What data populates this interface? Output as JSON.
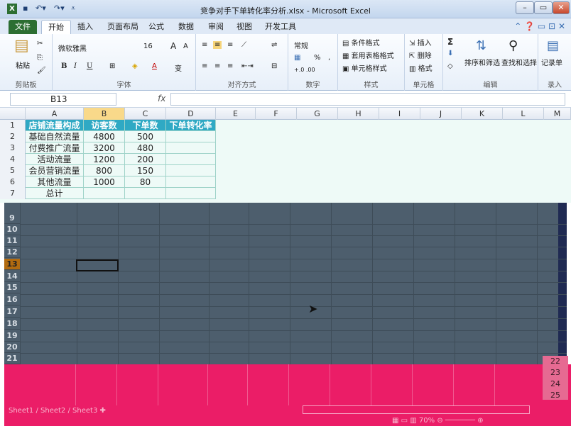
{
  "window": {
    "title": "竞争对手下单转化率分析.xlsx - Microsoft Excel",
    "min": "–",
    "max": "▭",
    "close": "✕"
  },
  "tabs": [
    "文件",
    "开始",
    "插入",
    "页面布局",
    "公式",
    "数据",
    "审阅",
    "视图",
    "开发工具"
  ],
  "ribbon": {
    "clipboard": {
      "paste": "粘贴",
      "label": "剪贴板"
    },
    "font": {
      "name": "微软雅黑",
      "size": "16",
      "grow": "A",
      "shrink": "A",
      "bold": "B",
      "italic": "I",
      "underline": "U",
      "wen": "变",
      "label": "字体"
    },
    "align": {
      "label": "对齐方式"
    },
    "number": {
      "format": "常规",
      "percent": "%",
      "comma": ",",
      "label": "数字"
    },
    "styles": {
      "cond": "条件格式",
      "table": "套用表格格式",
      "cell": "单元格样式",
      "label": "样式"
    },
    "cells": {
      "insert": "插入",
      "delete": "删除",
      "format": "格式",
      "label": "单元格"
    },
    "editing": {
      "sigma": "Σ",
      "sort": "排序和筛选",
      "find": "查找和选择",
      "label": "编辑"
    },
    "record": {
      "btn": "记录单",
      "label": "录入"
    }
  },
  "formula": {
    "namebox": "B13",
    "fx": "fx"
  },
  "columns": [
    "A",
    "B",
    "C",
    "D",
    "E",
    "F",
    "G",
    "H",
    "I",
    "J",
    "K",
    "L",
    "M"
  ],
  "table": {
    "headers": [
      "店铺流量构成",
      "访客数",
      "下单数",
      "下单转化率"
    ],
    "rows": [
      [
        "基础自然流量",
        "4800",
        "500",
        ""
      ],
      [
        "付费推广流量",
        "3200",
        "480",
        ""
      ],
      [
        "活动流量",
        "1200",
        "200",
        ""
      ],
      [
        "会员营销流量",
        "800",
        "150",
        ""
      ],
      [
        "其他流量",
        "1000",
        "80",
        ""
      ],
      [
        "总计",
        "",
        "",
        ""
      ]
    ]
  },
  "row_numbers": [
    "1",
    "2",
    "3",
    "4",
    "5",
    "6",
    "7"
  ],
  "dark_rows": [
    "9",
    "10",
    "11",
    "12",
    "13",
    "14",
    "15",
    "16",
    "17",
    "18",
    "19",
    "20",
    "21"
  ],
  "right_rows": [
    "22",
    "23",
    "24",
    "25"
  ],
  "sheets": [
    "Sheet1",
    "Sheet2",
    "Sheet3"
  ],
  "status": {
    "zoom": "70%"
  }
}
